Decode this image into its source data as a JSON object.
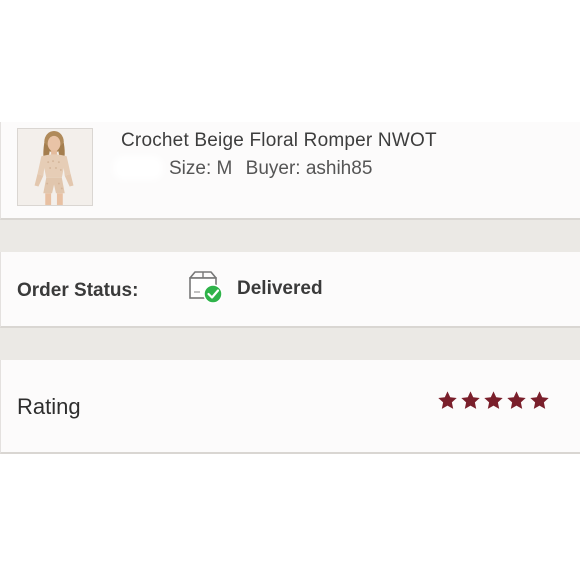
{
  "product": {
    "title": "Crochet Beige Floral Romper NWOT",
    "size_text": "Size: M",
    "buyer_text": "Buyer: ashih85",
    "thumbnail": "romper-photo"
  },
  "order_status": {
    "label": "Order Status:",
    "icon": "box-delivered-check-icon",
    "value": "Delivered",
    "check_color": "#2fb34a"
  },
  "rating": {
    "label": "Rating",
    "stars": 5,
    "max_stars": 5,
    "star_color": "#7a1f2b"
  }
}
